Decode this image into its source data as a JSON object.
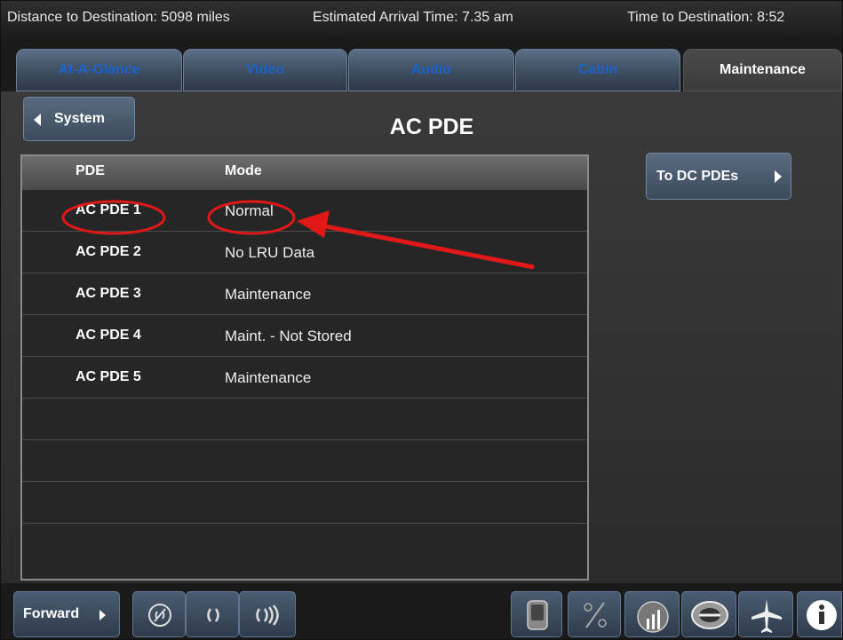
{
  "status_bar": {
    "distance": "Distance to Destination: 5098 miles",
    "arrival": "Estimated Arrival Time: 7.35 am",
    "time_to_dest": "Time to Destination: 8:52"
  },
  "tabs": [
    {
      "label": "At-A-Glance",
      "active": false
    },
    {
      "label": "Video",
      "active": false
    },
    {
      "label": "Audio",
      "active": false
    },
    {
      "label": "Cabin",
      "active": false
    },
    {
      "label": "Maintenance",
      "active": true
    }
  ],
  "header": {
    "back_button": "System",
    "title": "AC PDE",
    "dc_button": "To DC PDEs"
  },
  "table": {
    "columns": [
      "PDE",
      "Mode"
    ],
    "rows": [
      {
        "pde": "AC PDE 1",
        "mode": "Normal"
      },
      {
        "pde": "AC PDE 2",
        "mode": "No LRU Data"
      },
      {
        "pde": "AC PDE 3",
        "mode": "Maintenance"
      },
      {
        "pde": "AC PDE 4",
        "mode": "Maint. - Not Stored"
      },
      {
        "pde": "AC PDE 5",
        "mode": "Maintenance"
      },
      {
        "pde": "",
        "mode": ""
      },
      {
        "pde": "",
        "mode": ""
      },
      {
        "pde": "",
        "mode": ""
      },
      {
        "pde": "",
        "mode": ""
      }
    ]
  },
  "annotation": {
    "color": "#e01818"
  },
  "bottom_bar": {
    "forward_button": "Forward",
    "icons": [
      "mute-icon",
      "volume-down-icon",
      "volume-up-icon",
      "handset-icon",
      "temperature-icon",
      "lighting-icon",
      "window-shade-icon",
      "flight-map-icon",
      "info-icon"
    ]
  }
}
